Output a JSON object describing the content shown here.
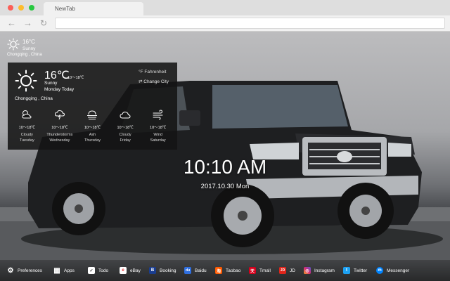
{
  "browser": {
    "tab_title": "NewTab",
    "back_glyph": "←",
    "forward_glyph": "→",
    "reload_glyph": "↻"
  },
  "weather_mini": {
    "temp": "16°C",
    "condition": "Sunny",
    "city": "Chongqing , China"
  },
  "weather_panel": {
    "temp": "16℃",
    "range": "10～18℃",
    "condition": "Sunny",
    "day": "Monday Today",
    "city": "Chongqing , China",
    "unit_toggle": "°F  Fahrenheit",
    "change_city": "⇄  Change City",
    "forecast": [
      {
        "icon": "cloudy-sun-icon",
        "range": "10～18℃",
        "condition": "Cloudy",
        "day": "Tuesday"
      },
      {
        "icon": "thunderstorm-icon",
        "range": "10～18℃",
        "condition": "Thunderstorms",
        "day": "Wednesday"
      },
      {
        "icon": "haze-icon",
        "range": "10～18℃",
        "condition": "Ash",
        "day": "Thursday"
      },
      {
        "icon": "cloud-icon",
        "range": "10～18℃",
        "condition": "Cloudy",
        "day": "Friday"
      },
      {
        "icon": "wind-icon",
        "range": "10～18℃",
        "condition": "Wind",
        "day": "Saturday"
      }
    ]
  },
  "clock": {
    "time": "10:10 AM",
    "date": "2017.10.30 Mon"
  },
  "bottom_bar": [
    {
      "label": "Preferences",
      "icon": "gear-icon",
      "color": "#ffffff",
      "glyph": "⚙"
    },
    {
      "label": "Apps",
      "icon": "apps-grid-icon",
      "color": "#ffffff",
      "glyph": "▦"
    },
    {
      "label": "Todo",
      "icon": "todo-check-icon",
      "color": "#ffffff",
      "glyph": "✓"
    },
    {
      "label": "eBay",
      "icon": "ebay-icon",
      "color": "#ffffff",
      "glyph": "e"
    },
    {
      "label": "Booking",
      "icon": "booking-icon",
      "color": "#1a3d8f",
      "glyph": "B"
    },
    {
      "label": "Baidu",
      "icon": "baidu-icon",
      "color": "#2f6fe0",
      "glyph": "du"
    },
    {
      "label": "Taobao",
      "icon": "taobao-icon",
      "color": "#ff5a00",
      "glyph": "淘"
    },
    {
      "label": "Tmall",
      "icon": "tmall-icon",
      "color": "#d6001c",
      "glyph": "天"
    },
    {
      "label": "JD",
      "icon": "jd-icon",
      "color": "#e1251b",
      "glyph": "JD"
    },
    {
      "label": "Instagram",
      "icon": "instagram-icon",
      "color": "#d62976",
      "glyph": "◎"
    },
    {
      "label": "Twitter",
      "icon": "twitter-icon",
      "color": "#1da1f2",
      "glyph": "t"
    },
    {
      "label": "Messenger",
      "icon": "messenger-icon",
      "color": "#0084ff",
      "glyph": "m"
    }
  ]
}
